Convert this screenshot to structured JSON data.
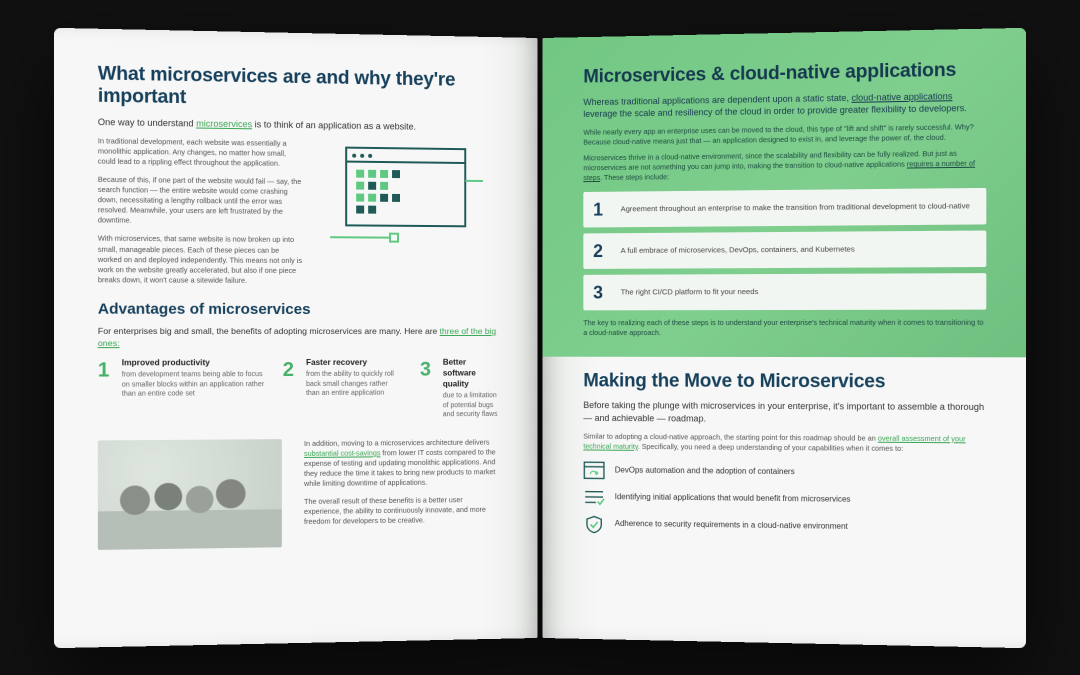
{
  "left": {
    "title": "What microservices are and why they're important",
    "lead_a": "One way to understand ",
    "lead_link": "microservices",
    "lead_b": " is to think of an application as a website.",
    "p1": "In traditional development, each website was essentially a monolithic application. Any changes, no matter how small, could lead to a rippling effect throughout the application.",
    "p2": "Because of this, if one part of the website would fail — say, the search function — the entire website would come crashing down, necessitating a lengthy rollback until the error was resolved. Meanwhile, your users are left frustrated by the downtime.",
    "p3": "With microservices, that same website is now broken up into small, manageable pieces. Each of these pieces can be worked on and deployed independently. This means not only is work on the website greatly accelerated, but also if one piece breaks down, it won't cause a sitewide failure.",
    "adv_title": "Advantages of microservices",
    "adv_lead_a": "For enterprises big and small, the benefits of adopting microservices are many. Here are ",
    "adv_lead_link": "three of the big ones:",
    "adv": [
      {
        "n": "1",
        "t": "Improved productivity",
        "d": "from development teams being able to focus on smaller blocks within an application rather than an entire code set"
      },
      {
        "n": "2",
        "t": "Faster recovery",
        "d": "from the ability to quickly roll back small changes rather than an entire application"
      },
      {
        "n": "3",
        "t": "Better software quality",
        "d": "due to a limitation of potential bugs and security flaws"
      }
    ],
    "p4a": "In addition, moving to a microservices architecture delivers ",
    "p4link": "substantial cost-savings",
    "p4b": " from lower IT costs compared to the expense of testing and updating monolithic applications. And they reduce the time it takes to bring new products to market while limiting downtime of applications.",
    "p5": "The overall result of these benefits is a better user experience, the ability to continuously innovate, and more freedom for developers to be creative."
  },
  "right": {
    "g_title": "Microservices & cloud-native applications",
    "g_lead_a": "Whereas traditional applications are dependent upon a static state, ",
    "g_lead_link": "cloud-native applications",
    "g_lead_b": " leverage the scale and resiliency of the cloud in order to provide greater flexibility to developers.",
    "g_p1": "While nearly every app an enterprise uses can be moved to the cloud, this type of \"lift and shift\" is rarely successful. Why? Because cloud-native means just that — an application designed to exist in, and leverage the power of, the cloud.",
    "g_p2a": "Microservices thrive in a cloud-native environment, since the scalability and flexibility can be fully realized. But just as microservices are not something you can jump into, making the transition to cloud-native applications ",
    "g_p2link": "requires a number of steps",
    "g_p2b": ". These steps include:",
    "steps": [
      {
        "n": "1",
        "t": "Agreement throughout an enterprise to make the transition from traditional development to cloud-native"
      },
      {
        "n": "2",
        "t": "A full embrace of microservices, DevOps, containers, and Kubernetes"
      },
      {
        "n": "3",
        "t": "The right CI/CD platform to fit your needs"
      }
    ],
    "g_foot": "The key to realizing each of these steps is to understand your enterprise's technical maturity when it comes to transitioning to a cloud-native approach.",
    "m_title": "Making the Move to Microservices",
    "m_lead": "Before taking the plunge with microservices in your enterprise, it's important to assemble a thorough — and achievable — roadmap.",
    "m_p_a": "Similar to adopting a cloud-native approach, the starting point for this roadmap should be an ",
    "m_p_link": "overall assessment of your technical maturity",
    "m_p_b": ". Specifically, you need a deep understanding of your capabilities when it comes to:",
    "bullets": [
      "DevOps automation and the adoption of containers",
      "Identifying initial applications that would benefit from microservices",
      "Adherence to security requirements in a cloud-native environment"
    ]
  }
}
